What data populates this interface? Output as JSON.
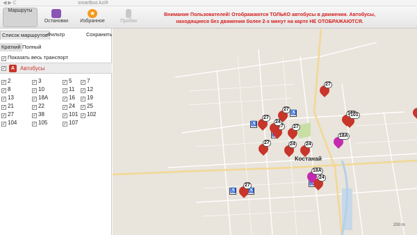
{
  "browser": {
    "url": "smartbus.kz/#",
    "nav": "◀ ▶ C"
  },
  "toolbar": {
    "buttons": [
      {
        "label": "Маршруты",
        "icon": "bus-route-icon"
      },
      {
        "label": "Остановки",
        "icon": "bus-stop-icon"
      },
      {
        "label": "Избранное",
        "icon": "star-icon"
      },
      {
        "label": "Пробки",
        "icon": "traffic-light-icon"
      }
    ],
    "notice": "Вниманиe Пользователей! Отображаются ТОЛЬКО автобусы в движении. Автобусы, находящиеся без движения более 2-х минут на карте НЕ ОТОБРАЖАЮТСЯ."
  },
  "panel": {
    "tabs": [
      "Список маршрутов",
      "Фильтр",
      "Сохранить"
    ],
    "subtabs": [
      "Краткий",
      "Полный"
    ],
    "show_all": "Показать весь транспорт",
    "group": {
      "badge": "А",
      "name": "Автобусы"
    },
    "routes": [
      "2",
      "3",
      "5",
      "7",
      "8",
      "10",
      "11",
      "12",
      "13",
      "18А",
      "16",
      "19",
      "21",
      "22",
      "24",
      "25",
      "27",
      "38",
      "101",
      "102",
      "104",
      "105",
      "107"
    ]
  },
  "map": {
    "city": "Костанай",
    "markers": [
      {
        "label": "27",
        "color": "#c8352a"
      },
      {
        "label": "27",
        "color": "#c8352a"
      },
      {
        "label": "27",
        "color": "#c8352a"
      },
      {
        "label": "27",
        "color": "#c8352a"
      },
      {
        "label": "24",
        "color": "#c8352a"
      },
      {
        "label": "27",
        "color": "#c8352a"
      },
      {
        "label": "24",
        "color": "#c8352a"
      },
      {
        "label": "27",
        "color": "#c8352a"
      },
      {
        "label": "24",
        "color": "#c8352a"
      },
      {
        "label": "101",
        "color": "#c8352a"
      },
      {
        "label": "18А",
        "color": "#c42ab0"
      },
      {
        "label": "18А",
        "color": "#c42ab0"
      },
      {
        "label": "24",
        "color": "#c8352a"
      },
      {
        "label": "27",
        "color": "#c8352a"
      },
      {
        "label": "24",
        "color": "#c8352a"
      },
      {
        "label": "101",
        "color": "#c8352a"
      }
    ],
    "scale": "200 m"
  }
}
